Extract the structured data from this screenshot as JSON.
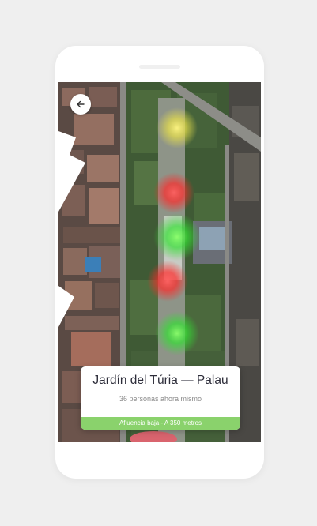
{
  "header": {
    "back_icon": "arrow-left-icon"
  },
  "place": {
    "title": "Jardín del Túria — Palau",
    "occupancy": "36 personas ahora mismo",
    "status": "Afluencia baja - A 350 metros",
    "status_color": "#8ad26c"
  },
  "map": {
    "hotspots": [
      {
        "name": "hotspot-yellow",
        "color": "#e8e04a",
        "level": "medio"
      },
      {
        "name": "hotspot-red",
        "color": "#ff3a3a",
        "level": "alto"
      },
      {
        "name": "hotspot-green",
        "color": "#3fe03f",
        "level": "bajo"
      },
      {
        "name": "hotspot-red",
        "color": "#ff3a3a",
        "level": "alto"
      },
      {
        "name": "hotspot-green",
        "color": "#3fe03f",
        "level": "bajo"
      }
    ]
  }
}
